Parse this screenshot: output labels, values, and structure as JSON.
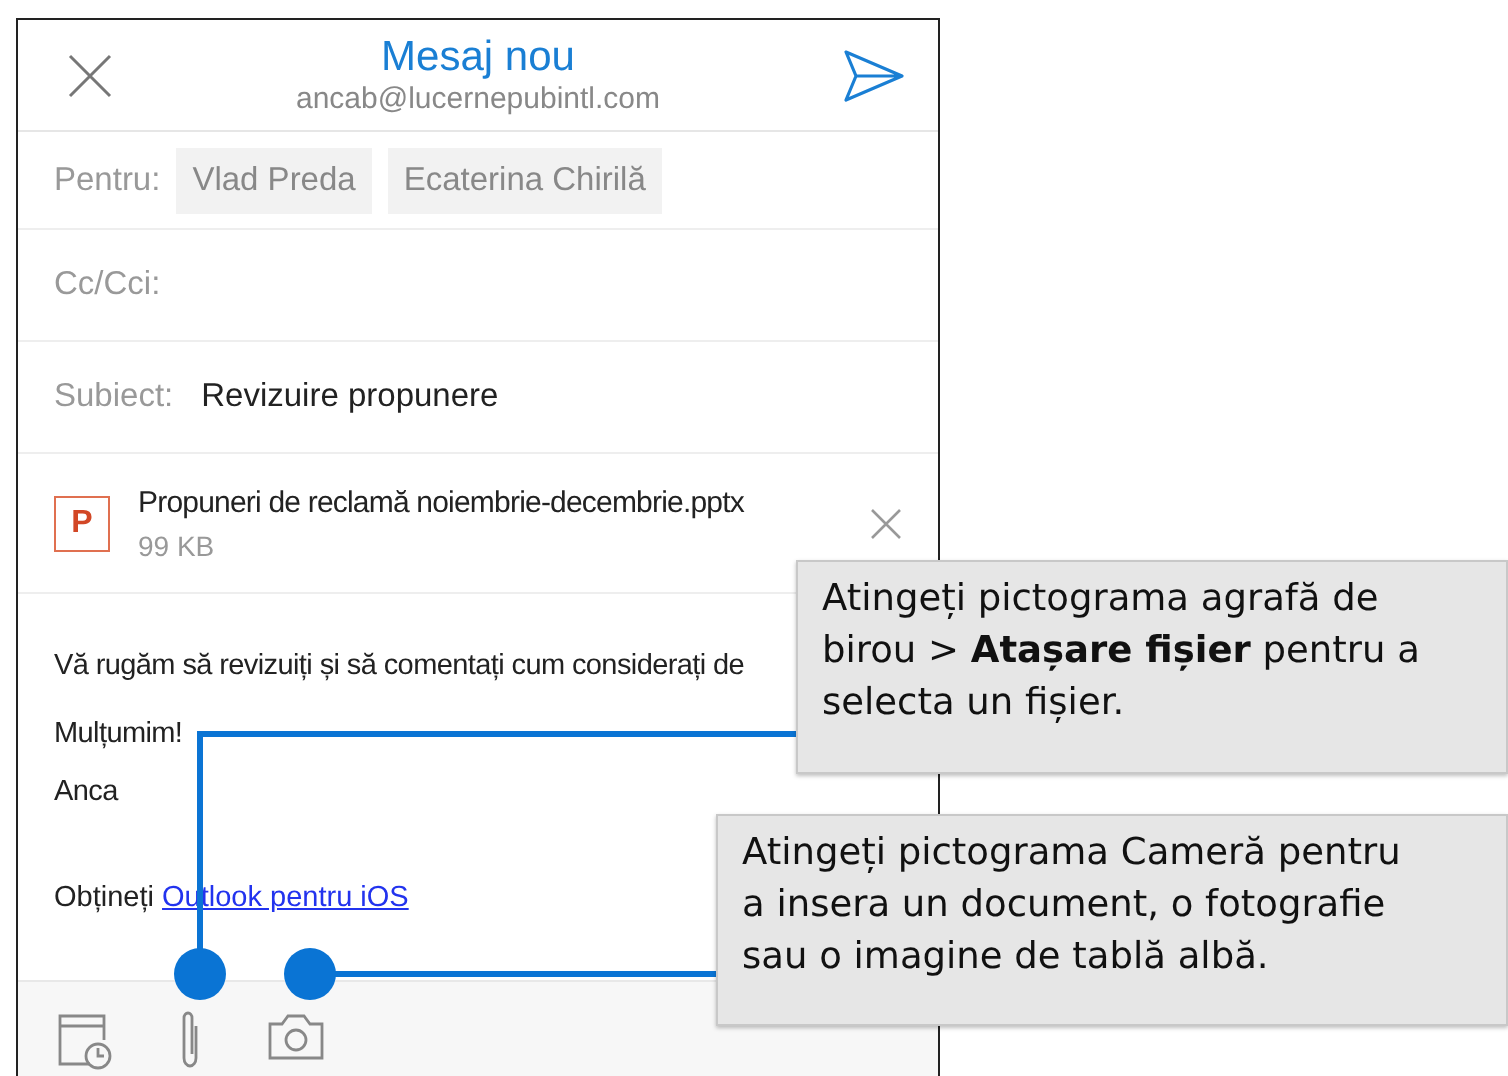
{
  "header": {
    "title": "Mesaj nou",
    "account": "ancab@lucernepubintl.com"
  },
  "to": {
    "label": "Pentru:",
    "recipients": [
      "Vlad Preda",
      "Ecaterina Chirilă"
    ]
  },
  "cc": {
    "label": "Cc/Cci:"
  },
  "subject": {
    "label": "Subiect:",
    "value": "Revizuire propunere"
  },
  "attachment": {
    "icon_letter": "P",
    "name": "Propuneri de reclamă noiembrie-decembrie.pptx",
    "size": "99 KB"
  },
  "body": {
    "lines": [
      "Vă rugăm să revizuiți și să comentați cum considerați de",
      "Mulțumim!",
      "Anca"
    ],
    "signature_prefix": "Obțineți",
    "signature_link": "Outlook pentru iOS"
  },
  "callouts": [
    {
      "text": "Atingeți pictograma agrafă de birou > **Atașare fișier** pentru a selecta un fișier."
    },
    {
      "text": "Atingeți pictograma Cameră pentru a insera un document, o fotografie sau o imagine de tablă albă."
    }
  ]
}
